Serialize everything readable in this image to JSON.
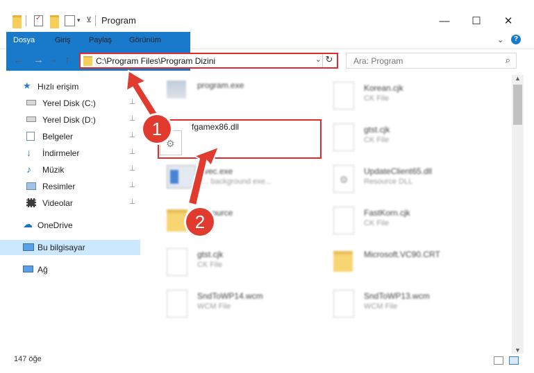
{
  "window": {
    "title": "Program",
    "controls": {
      "minimize": "—",
      "maximize": "☐",
      "close": "✕"
    }
  },
  "ribbon": {
    "tabs": [
      "Dosya",
      "Giriş",
      "Paylaş",
      "Görünüm"
    ],
    "help": "?"
  },
  "address": {
    "path": "C:\\Program Files\\Program Dizini",
    "dropdown": "⌄",
    "refresh": "↻"
  },
  "search": {
    "placeholder": "Ara: Program",
    "icon": "⌕"
  },
  "sidebar": {
    "items": [
      {
        "label": "Hızlı erişim",
        "icon": "star-icon",
        "pinned": false
      },
      {
        "label": "Yerel Disk (C:)",
        "icon": "drive-icon",
        "pinned": true
      },
      {
        "label": "Yerel Disk (D:)",
        "icon": "drive-icon",
        "pinned": true
      },
      {
        "label": "Belgeler",
        "icon": "documents-icon",
        "pinned": true
      },
      {
        "label": "İndirmeler",
        "icon": "download-icon",
        "pinned": true
      },
      {
        "label": "Müzik",
        "icon": "music-icon",
        "pinned": true
      },
      {
        "label": "Resimler",
        "icon": "pictures-icon",
        "pinned": true
      },
      {
        "label": "Videolar",
        "icon": "videos-icon",
        "pinned": true
      },
      {
        "label": "OneDrive",
        "icon": "cloud-icon",
        "pinned": false
      },
      {
        "label": "Bu bilgisayar",
        "icon": "computer-icon",
        "pinned": false,
        "selected": true
      },
      {
        "label": "Ağ",
        "icon": "network-icon",
        "pinned": false
      }
    ],
    "pin_glyph": "📌"
  },
  "files": {
    "left": [
      {
        "name": "program.exe",
        "type": ""
      },
      {
        "name": "fgamex86.dll",
        "type": ""
      },
      {
        "name": "...vec.exe",
        "type": "A... background exe..."
      },
      {
        "name": "Resource",
        "type": ""
      },
      {
        "name": "gtst.cjk",
        "type": "CK File"
      },
      {
        "name": "SndToWP14.wcm",
        "type": "WCM File"
      }
    ],
    "right": [
      {
        "name": "Korean.cjk",
        "type": "CK File"
      },
      {
        "name": "gtst.cjk",
        "type": "CK File"
      },
      {
        "name": "UpdateClient65.dll",
        "type": "Resource DLL"
      },
      {
        "name": "FastKorn.cjk",
        "type": "CK File"
      },
      {
        "name": "Microsoft.VC90.CRT",
        "type": ""
      },
      {
        "name": "SndToWP13.wcm",
        "type": "WCM File"
      }
    ]
  },
  "annotations": {
    "step1": "1",
    "step2": "2"
  },
  "status": {
    "count": "147 öğe"
  },
  "colors": {
    "accent": "#1979ca",
    "highlight": "#e4292b",
    "selection": "#cce8ff"
  }
}
